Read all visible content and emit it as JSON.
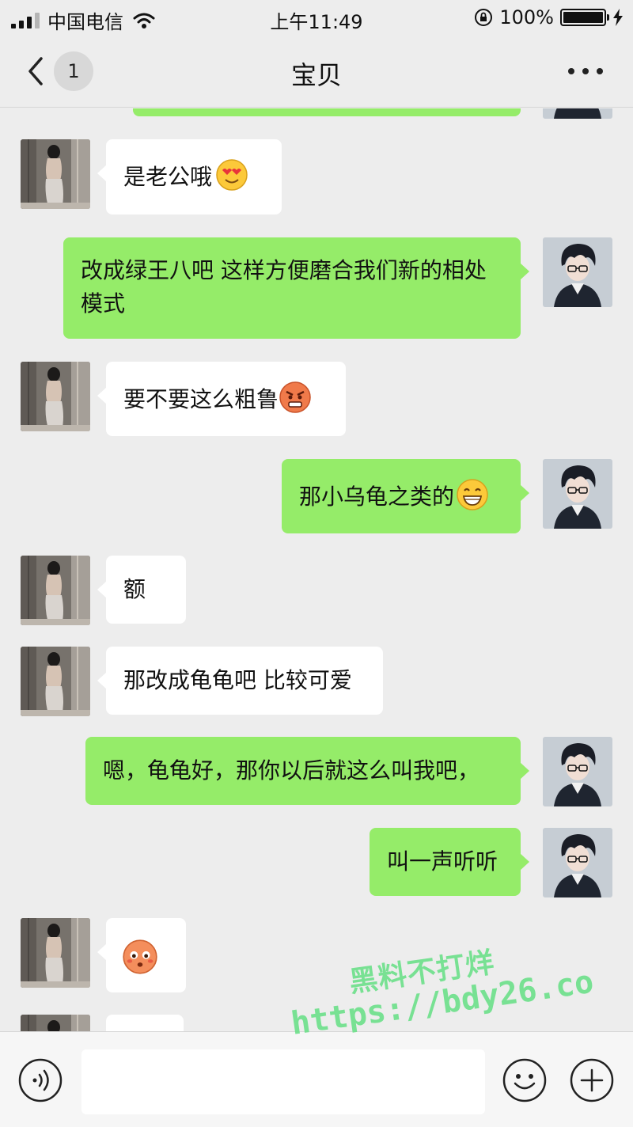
{
  "status_bar": {
    "carrier": "中国电信",
    "time": "上午11:49",
    "battery_percent": "100%",
    "icons": [
      "signal-icon",
      "wifi-icon",
      "orientation-lock-icon",
      "battery-icon",
      "charging-bolt-icon"
    ]
  },
  "nav": {
    "back_icon": "chevron-left-icon",
    "unread_count": "1",
    "title": "宝贝",
    "more_icon": "more-dots-icon"
  },
  "messages": [
    {
      "side": "in",
      "text": "是老公哦",
      "emoji": "heart-eyes-emoji"
    },
    {
      "side": "out",
      "text": "改成绿王八吧 这样方便磨合我们新的相处模式"
    },
    {
      "side": "in",
      "text": "要不要这么粗鲁",
      "emoji": "angry-emoji"
    },
    {
      "side": "out",
      "text": "那小乌龟之类的",
      "emoji": "grin-emoji"
    },
    {
      "side": "in",
      "text": "额"
    },
    {
      "side": "in",
      "text": "那改成龟龟吧 比较可爱"
    },
    {
      "side": "out",
      "text": "嗯，龟龟好，那你以后就这么叫我吧，"
    },
    {
      "side": "out",
      "text": "叫一声听听"
    },
    {
      "side": "in",
      "text": "",
      "emoji": "blushing-emoji"
    }
  ],
  "input_bar": {
    "icons": [
      "voice-icon",
      "emoji-icon",
      "plus-icon"
    ],
    "placeholder": ""
  },
  "watermark": {
    "line1": "黑料不打烊",
    "line2": "https://bdy26.co"
  },
  "colors": {
    "background": "#ededed",
    "outgoing_bubble": "#95ec69",
    "incoming_bubble": "#ffffff",
    "watermark": "#6fe08c"
  }
}
